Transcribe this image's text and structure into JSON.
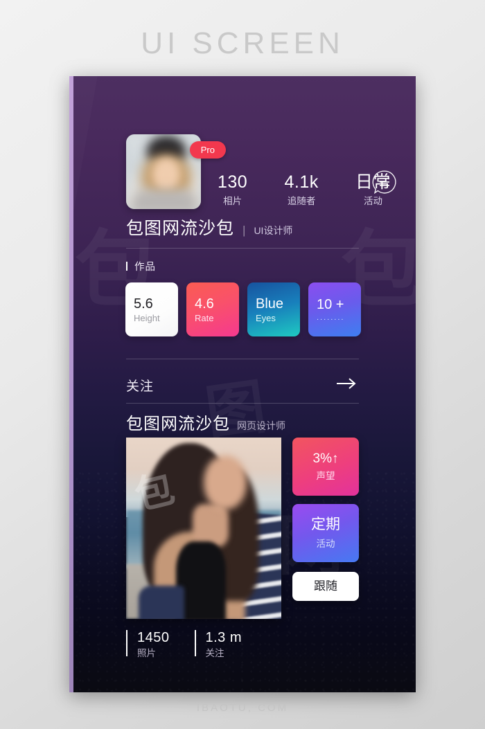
{
  "page": {
    "title": "UI SCREEN",
    "footer": "IBAOTU, COM"
  },
  "phone": {
    "topbar": {
      "menu_icon": "chat-bubble-menu-icon"
    },
    "profile": {
      "avatar_alt": "profile-avatar",
      "pro_badge": "Pro",
      "name": "包图网流沙包",
      "separator": "|",
      "role": "UI设计师",
      "stats": [
        {
          "value": "130",
          "label": "相片"
        },
        {
          "value": "4.1k",
          "label": "追随者"
        },
        {
          "value": "日常",
          "label": "活动"
        }
      ]
    },
    "works": {
      "section_label": "作品",
      "cards": [
        {
          "big": "5.6",
          "sub": "Height",
          "style": "white"
        },
        {
          "big": "4.6",
          "sub": "Rate",
          "style": "red"
        },
        {
          "big": "Blue",
          "sub": "Eyes",
          "style": "blue"
        },
        {
          "big": "10 +",
          "sub": "........",
          "style": "purple"
        }
      ]
    },
    "follow_row": {
      "label": "关注",
      "arrow_icon": "arrow-right-icon"
    },
    "featured": {
      "name": "包图网流沙包",
      "role": "网页设计师",
      "photo_alt": "featured-photo",
      "photo_watermark": "包",
      "side_cards": [
        {
          "big": "3%↑",
          "sub": "声望",
          "style": "pink"
        },
        {
          "big": "定期",
          "sub": "活动",
          "style": "blue"
        },
        {
          "big": "跟随",
          "sub": "",
          "style": "white"
        }
      ],
      "bottom_stats": [
        {
          "value": "1450",
          "label": "照片"
        },
        {
          "value": "1.3 m",
          "label": "关注"
        }
      ]
    },
    "watermarks": [
      "包",
      "包",
      "图",
      "网"
    ]
  },
  "colors": {
    "accent_red": "#f2384e",
    "card_red_start": "#fb5c52",
    "card_red_end": "#f5398f",
    "card_blue_start": "#17539f",
    "card_blue_end": "#1fcac1",
    "card_purple_start": "#8b4ef0",
    "card_purple_end": "#3e7ef0",
    "bg_top": "#4d2f61",
    "bg_bottom": "#0a0a12"
  }
}
